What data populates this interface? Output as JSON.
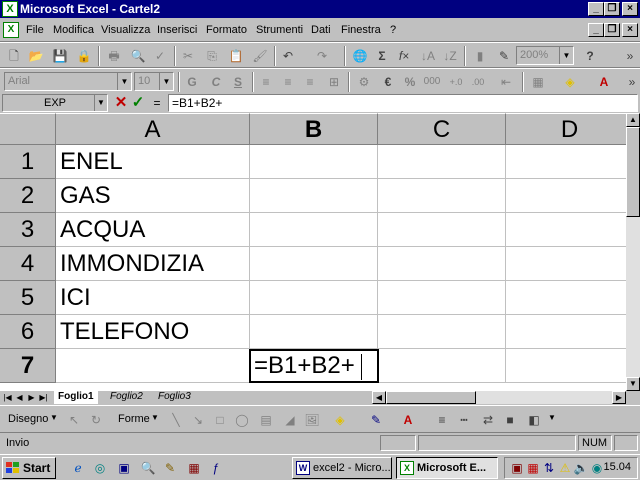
{
  "window": {
    "title": "Microsoft Excel - Cartel2",
    "buttons": [
      "_",
      "\u0019",
      "×"
    ]
  },
  "menubar": {
    "items": [
      "File",
      "Modifica",
      "Visualizza",
      "Inserisci",
      "Formato",
      "Strumenti",
      "Dati",
      "Finestra",
      "?"
    ]
  },
  "toolbar_standard": {
    "zoom": "200%"
  },
  "toolbar_format": {
    "font": "Arial",
    "size": "10",
    "bold": "G",
    "italic": "C",
    "underline": "S",
    "currency": "€",
    "percent": "%",
    "thousands": "000"
  },
  "formula_bar": {
    "name_box": "EXP",
    "equals": "=",
    "content": "=B1+B2+"
  },
  "grid": {
    "columns": [
      "A",
      "B",
      "C",
      "D"
    ],
    "active_column": "B",
    "rows": [
      {
        "num": "1",
        "a": "ENEL"
      },
      {
        "num": "2",
        "a": "GAS"
      },
      {
        "num": "3",
        "a": "ACQUA"
      },
      {
        "num": "4",
        "a": "IMMONDIZIA"
      },
      {
        "num": "5",
        "a": "ICI"
      },
      {
        "num": "6",
        "a": "TELEFONO"
      },
      {
        "num": "7",
        "a": ""
      }
    ],
    "active_row": "7",
    "editing_cell": {
      "ref": "B7",
      "value": "=B1+B2+"
    }
  },
  "sheets": {
    "tabs": [
      "Foglio1",
      "Foglio2",
      "Foglio3"
    ],
    "active": "Foglio1"
  },
  "drawing_toolbar": {
    "draw_label": "Disegno",
    "shapes_label": "Forme"
  },
  "status": {
    "mode": "Invio",
    "num": "NUM"
  },
  "taskbar": {
    "start": "Start",
    "tasks": [
      {
        "label": "excel2 - Micro...",
        "icon": "W",
        "active": false
      },
      {
        "label": "Microsoft E...",
        "icon": "X",
        "active": true
      }
    ],
    "clock": "15.04"
  }
}
